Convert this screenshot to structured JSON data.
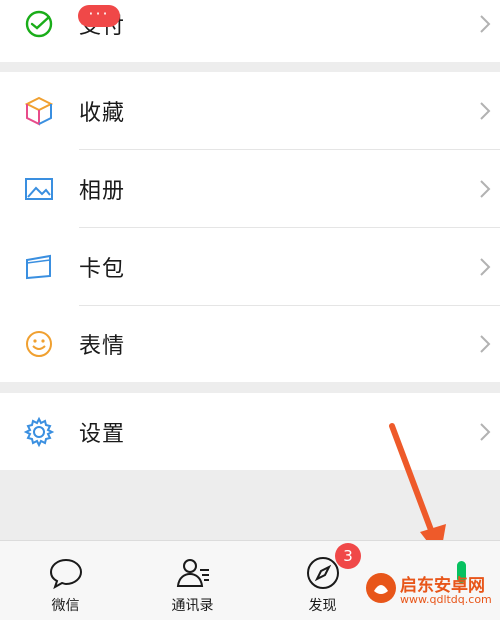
{
  "menu": {
    "pay": {
      "label": "支付",
      "icon": "pay-check-icon"
    },
    "favorites": {
      "label": "收藏",
      "icon": "cube-icon"
    },
    "album": {
      "label": "相册",
      "icon": "picture-icon"
    },
    "cards": {
      "label": "卡包",
      "icon": "wallet-card-icon"
    },
    "stickers": {
      "label": "表情",
      "icon": "smiley-icon"
    },
    "settings": {
      "label": "设置",
      "icon": "gear-icon"
    }
  },
  "tabbar": {
    "chats": {
      "label": "微信",
      "badge": "···"
    },
    "contacts": {
      "label": "通讯录"
    },
    "discover": {
      "label": "发现",
      "badge": "3"
    }
  },
  "watermark": {
    "name": "启东安卓网",
    "url": "www.qdltdq.com"
  },
  "colors": {
    "accent_green": "#07c160",
    "badge_red": "#f04848",
    "arrow_orange": "#ee5a2a"
  }
}
